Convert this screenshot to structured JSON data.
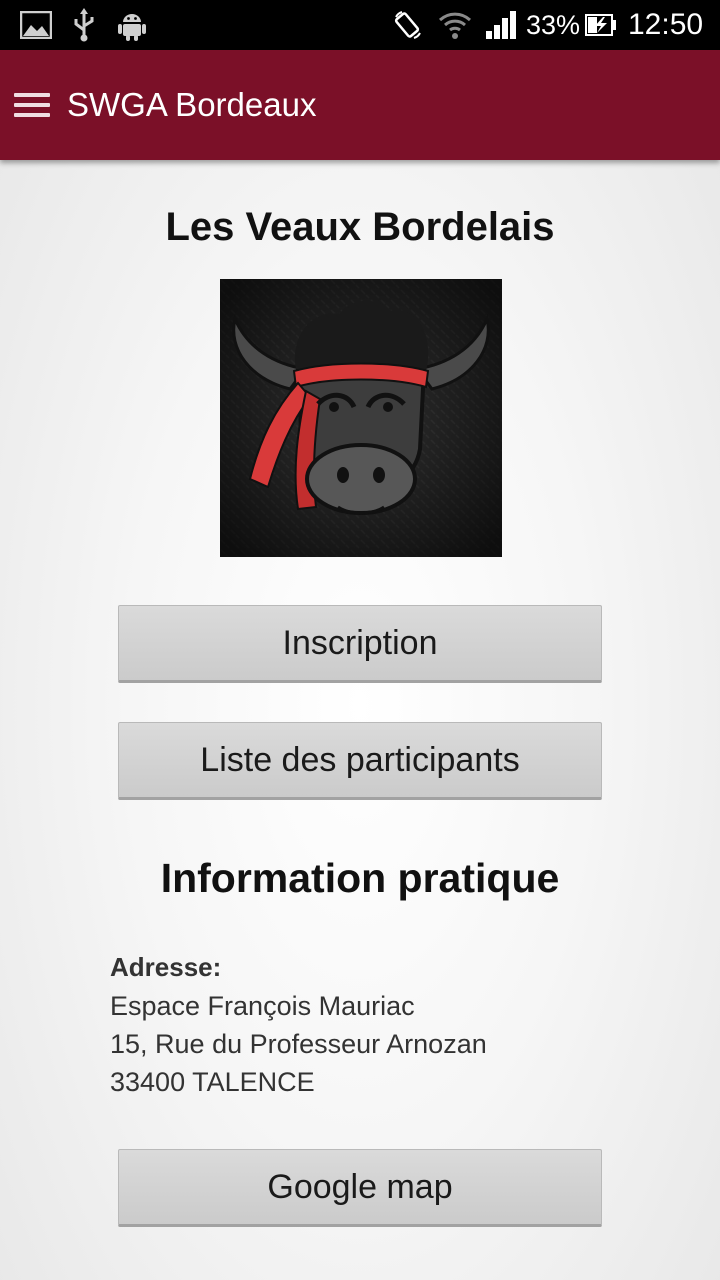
{
  "status_bar": {
    "icons": [
      "image-icon",
      "usb-icon",
      "android-icon",
      "rotate-icon",
      "wifi-icon",
      "signal-icon",
      "battery-icon"
    ],
    "battery": "33%",
    "time": "12:50"
  },
  "app_bar": {
    "title": "SWGA Bordeaux",
    "color": "#7b1028"
  },
  "event": {
    "title": "Les Veaux Bordelais",
    "logo_icon": "bull-logo-icon"
  },
  "buttons": {
    "inscription": "Inscription",
    "participants": "Liste des participants",
    "google_map": "Google map"
  },
  "info": {
    "title": "Information pratique",
    "address_label": "Adresse:",
    "address_lines": [
      "Espace François Mauriac",
      "15, Rue du Professeur Arnozan",
      "33400 TALENCE"
    ]
  }
}
